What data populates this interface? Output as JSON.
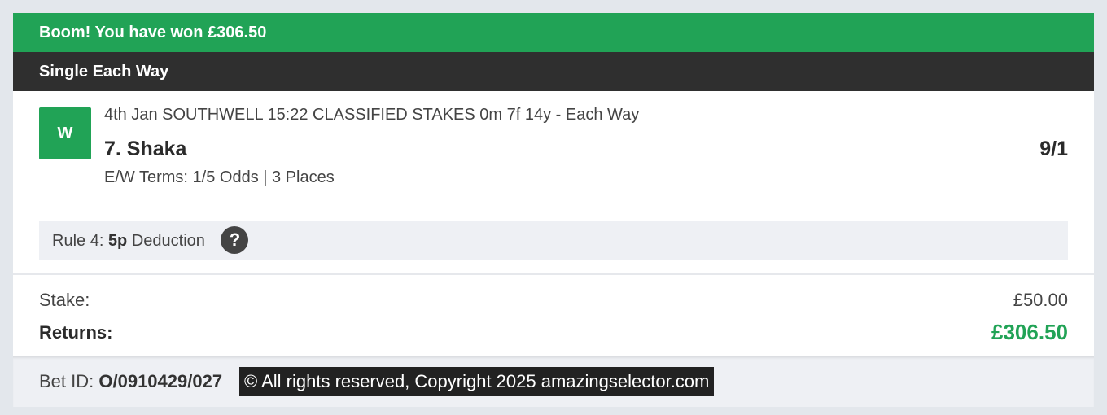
{
  "banner": {
    "text": "Boom! You have won £306.50"
  },
  "bet_type": {
    "label": "Single Each Way"
  },
  "selection": {
    "result_badge": "W",
    "event": "4th Jan SOUTHWELL 15:22 CLASSIFIED STAKES 0m 7f 14y - Each Way",
    "name": "7. Shaka",
    "odds": "9/1",
    "ew_terms": "E/W Terms: 1/5 Odds | 3 Places"
  },
  "rule4": {
    "prefix": "Rule 4:",
    "amount": "5p",
    "suffix": "Deduction",
    "help_icon": "question-icon"
  },
  "summary": {
    "stake_label": "Stake:",
    "stake_value": "£50.00",
    "returns_label": "Returns:",
    "returns_value": "£306.50"
  },
  "footer": {
    "bet_id_label": "Bet ID:",
    "bet_id_value": "O/0910429/027",
    "copyright": "© All rights reserved, Copyright 2025 amazingselector.com"
  },
  "colors": {
    "win_green": "#21a356",
    "header_dark": "#2f2f2f",
    "panel_gray": "#eef0f4"
  }
}
